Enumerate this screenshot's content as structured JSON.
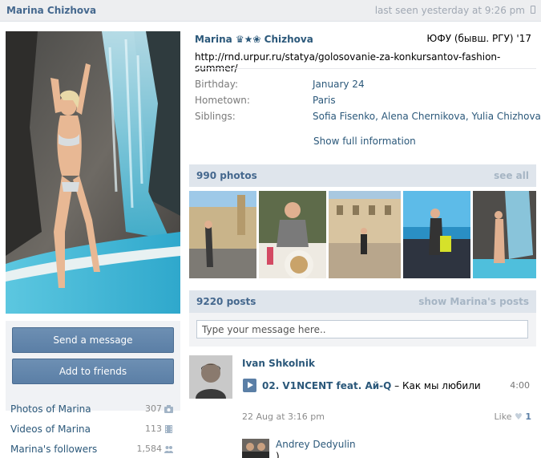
{
  "topbar": {
    "name": "Marina Chizhova",
    "last_seen": "last seen yesterday at 9:26 pm"
  },
  "sidebar": {
    "send_message": "Send a message",
    "add_friends": "Add to friends",
    "counters": [
      {
        "label": "Photos of Marina",
        "count": "307",
        "icon": "camera-icon"
      },
      {
        "label": "Videos of Marina",
        "count": "113",
        "icon": "film-icon"
      },
      {
        "label": "Marina's followers",
        "count": "1,584",
        "icon": "people-icon"
      }
    ]
  },
  "profile": {
    "first_name": "Marina",
    "decoration": "♛★❀",
    "last_name": "Chizhova",
    "university": "ЮФУ (бывш. РГУ) '17",
    "status": "http://rnd.urpur.ru/statya/golosovanie-za-konkursantov-fashion-summer/",
    "info": {
      "birthday_label": "Birthday:",
      "birthday": "January 24",
      "hometown_label": "Hometown:",
      "hometown": "Paris",
      "siblings_label": "Siblings:",
      "siblings": [
        "Sofia Fisenko",
        "Alena Chernikova",
        "Yulia Chizhova"
      ]
    },
    "show_full": "Show full information"
  },
  "photos": {
    "title": "990 photos",
    "see_all": "see all"
  },
  "posts": {
    "title": "9220 posts",
    "show_link": "show Marina's posts",
    "compose_placeholder": "Type your message here.."
  },
  "post": {
    "author": "Ivan Shkolnik",
    "track_artist": "02. V1NCENT feat. Ай-Q",
    "track_sep": " – ",
    "track_title": "Как мы любили",
    "duration": "4:00",
    "date": "22 Aug at 3:16 pm",
    "like_label": "Like",
    "like_count": "1",
    "comment_author": "Andrey Dedyulin",
    "comment_text": ")"
  },
  "colors": {
    "link": "#2b587a",
    "header_bg": "#dfe5ec",
    "button": "#5b7fa6"
  }
}
